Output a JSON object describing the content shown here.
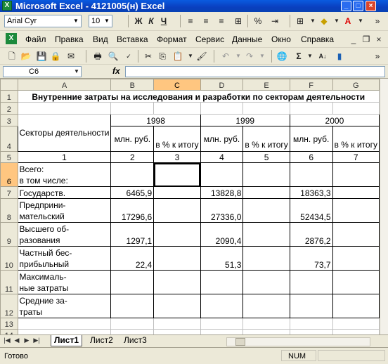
{
  "window": {
    "title": "Microsoft Excel - 4121005(н) Excel",
    "app_icon": "excel-icon"
  },
  "format_toolbar": {
    "font_name": "Arial Cyr",
    "font_size": "10",
    "bold": "Ж",
    "italic": "К",
    "underline": "Ч"
  },
  "menu": [
    "Файл",
    "Правка",
    "Вид",
    "Вставка",
    "Формат",
    "Сервис",
    "Данные",
    "Окно",
    "Справка"
  ],
  "formula_bar": {
    "name_box": "C6",
    "fx": "fx",
    "value": ""
  },
  "columns": [
    "A",
    "B",
    "C",
    "D",
    "E",
    "F",
    "G"
  ],
  "selected_column": "C",
  "selected_row": "6",
  "rows": {
    "r1": "1",
    "r2": "2",
    "r3": "3",
    "r4": "4",
    "r5": "5",
    "r6": "6",
    "r7": "7",
    "r8": "8",
    "r9": "9",
    "r10": "10",
    "r11": "11",
    "r12": "12",
    "r13": "13",
    "r14": "14"
  },
  "cells": {
    "title": "Внутренние затраты на исследования и разработки по секторам деятельности",
    "sectors_header": "Секторы деятельности",
    "y1998": "1998",
    "y1999": "1999",
    "y2000": "2000",
    "mln_rub_1": "млн. руб.",
    "pct_1": "в % к итогу",
    "mln_rub_2": "млн. руб.",
    "pct_2": "в % к итогу",
    "mln_rub_3": "млн. руб.",
    "pct_3": "в % к итогу",
    "n1": "1",
    "n2": "2",
    "n3": "3",
    "n4": "4",
    "n5": "5",
    "n6": "6",
    "n7": "7",
    "total": "Всего:",
    "total_sub": "в том числе:",
    "gov": "Государств.",
    "gov_1998": "6465,9",
    "gov_1999": "13828,8",
    "gov_2000": "18363,3",
    "ent_1": "Предприни-",
    "ent_2": "мательский",
    "ent_1998": "17296,6",
    "ent_1999": "27336,0",
    "ent_2000": "52434,5",
    "edu_1": "Высшего об-",
    "edu_2": "разования",
    "edu_1998": "1297,1",
    "edu_1999": "2090,4",
    "edu_2000": "2876,2",
    "priv_1": "Частный бес-",
    "priv_2": "прибыльный",
    "priv_1998": "22,4",
    "priv_1999": "51,3",
    "priv_2000": "73,7",
    "max_1": "Максималь-",
    "max_2": "ные затраты",
    "avg_1": "Средние за-",
    "avg_2": "траты"
  },
  "sheet_tabs": [
    "Лист1",
    "Лист2",
    "Лист3"
  ],
  "status": {
    "ready": "Готово",
    "num": "NUM"
  }
}
